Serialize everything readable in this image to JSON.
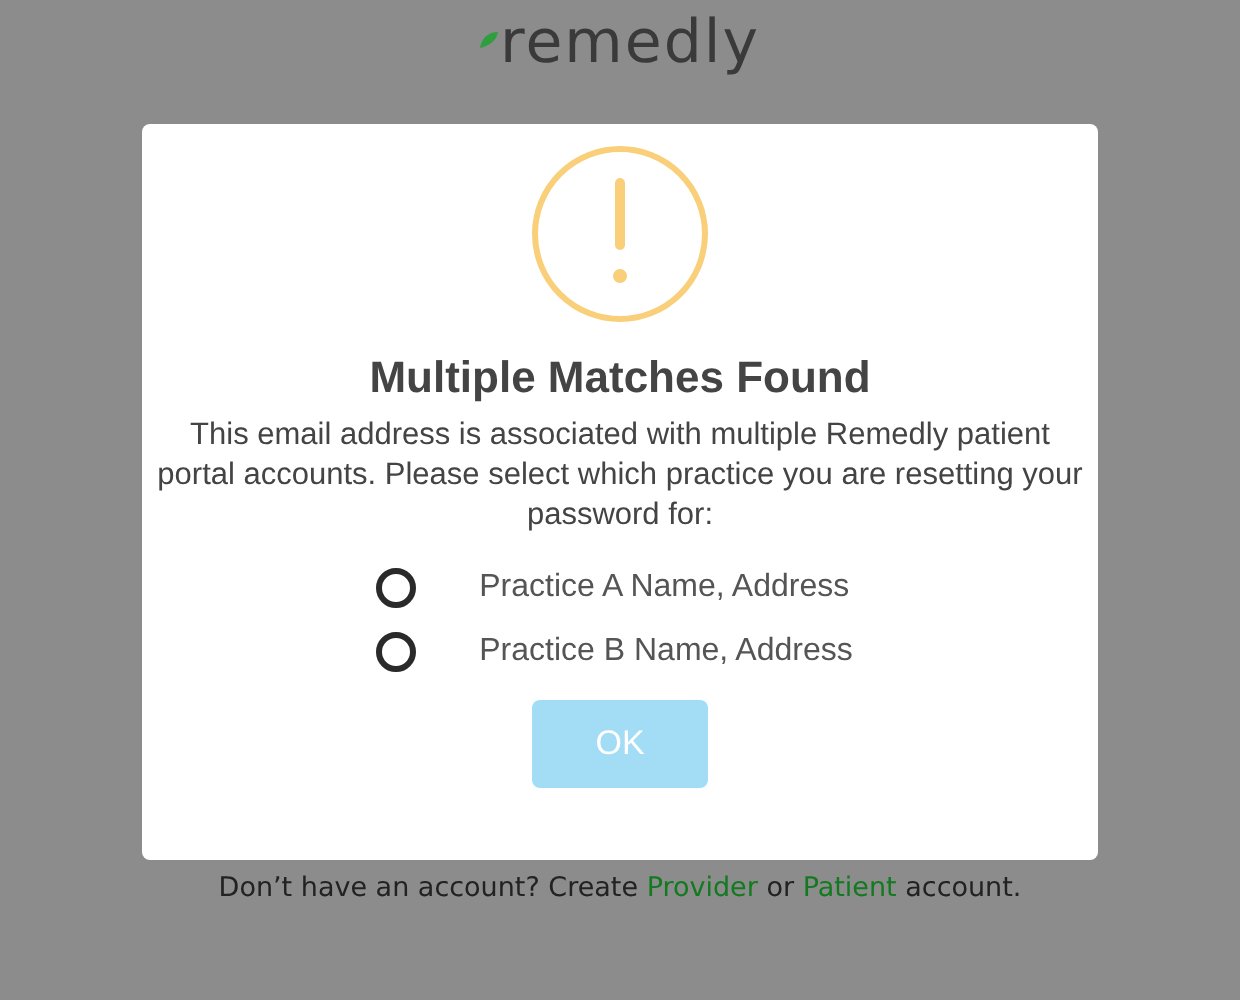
{
  "logo": {
    "text": "remedly"
  },
  "dialog": {
    "title": "Multiple Matches Found",
    "message": "This email address is associated with multiple Remedly patient portal accounts. Please select which practice you are resetting your password for:",
    "options": [
      {
        "label": "Practice A Name, Address",
        "selected": false
      },
      {
        "label": "Practice B Name, Address",
        "selected": false
      }
    ],
    "button": {
      "label": "OK",
      "disabled": true
    }
  },
  "footer": {
    "before": "Don’t have an account? Create",
    "links": [
      "Provider",
      "Patient"
    ],
    "between": "or",
    "after": "account."
  }
}
